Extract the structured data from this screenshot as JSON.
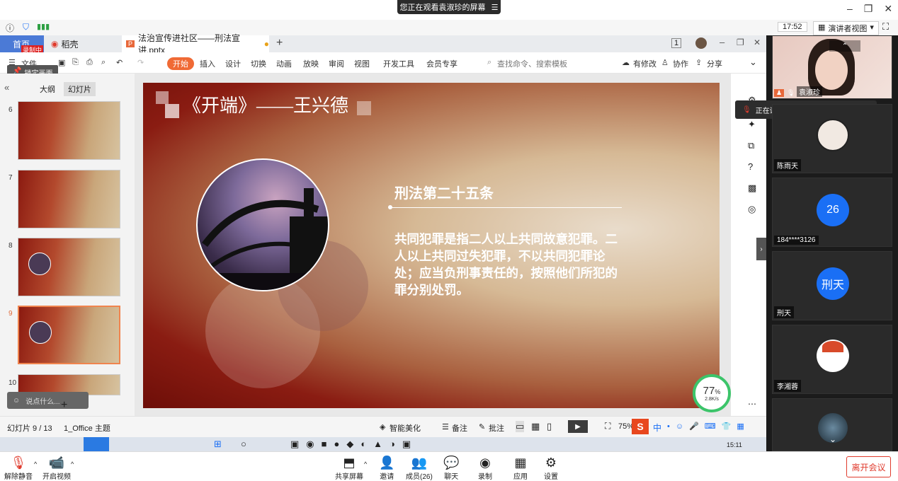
{
  "banner": {
    "text": "您正在观看袁淑珍的屏幕",
    "icon": "menu-icon"
  },
  "meeting_header": {
    "time": "17:52",
    "view_mode": "演讲者视图"
  },
  "tabs": [
    {
      "label": "首页"
    },
    {
      "label": "稻壳"
    },
    {
      "label": "法治宣传进社区——刑法宣讲.pptx"
    }
  ],
  "rec_badge": "录制中",
  "ribbon": {
    "file": "文件",
    "items": [
      "开始",
      "插入",
      "设计",
      "切换",
      "动画",
      "放映",
      "审阅",
      "视图",
      "开发工具",
      "会员专享"
    ],
    "search_placeholder": "查找命令、搜索模板",
    "right": [
      "有修改",
      "协作",
      "分享"
    ]
  },
  "lock_tip": "锁定画面",
  "panel_tabs": [
    "大纲",
    "幻灯片"
  ],
  "thumbnails": [
    {
      "num": "6"
    },
    {
      "num": "7"
    },
    {
      "num": "8"
    },
    {
      "num": "9"
    },
    {
      "num": "10"
    }
  ],
  "chat_placeholder": "说点什么...",
  "slide": {
    "title": "《开端》——王兴德",
    "heading": "刑法第二十五条",
    "body": "共同犯罪是指二人以上共同故意犯罪。二人以上共同过失犯罪，不以共同犯罪论处；应当负刑事责任的，按照他们所犯的罪分别处罚。"
  },
  "net_widget": {
    "percent": "77",
    "unit": "%",
    "speed": "2.8K/s"
  },
  "status": {
    "slide_info": "幻灯片 9 / 13",
    "theme": "1_Office 主题",
    "beautify": "智能美化",
    "notes": "备注",
    "comment": "批注",
    "zoom": "75%"
  },
  "ime": {
    "mode": "中"
  },
  "taskbar_time": "15:11",
  "bottom": {
    "unmute": "解除静音",
    "video": "开启视频",
    "share": "共享屏幕",
    "invite": "邀请",
    "members": "成员(26)",
    "chat": "聊天",
    "record": "录制",
    "apps": "应用",
    "settings": "设置",
    "leave": "离开会议"
  },
  "participants": {
    "speaking_label": "正在讲话: 袁淑珍;",
    "list": [
      {
        "name": "袁淑珍"
      },
      {
        "name": "陈雨天"
      },
      {
        "name": "184****3126",
        "avatar_text": "26"
      },
      {
        "name": "刑天",
        "avatar_text": "刑天"
      },
      {
        "name": "李湘蓉"
      }
    ]
  }
}
